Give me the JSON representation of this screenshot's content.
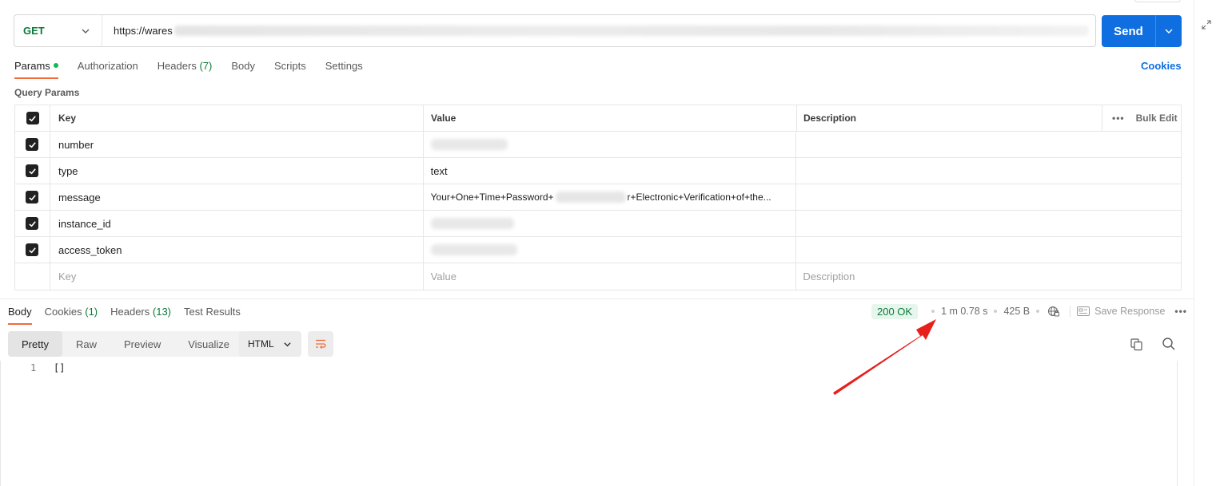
{
  "request": {
    "method": "GET",
    "url_prefix": "https://wares",
    "send_label": "Send"
  },
  "request_tabs": [
    {
      "label": "Params",
      "count": ""
    },
    {
      "label": "Authorization",
      "count": ""
    },
    {
      "label": "Headers",
      "count": "(7)"
    },
    {
      "label": "Body",
      "count": ""
    },
    {
      "label": "Scripts",
      "count": ""
    },
    {
      "label": "Settings",
      "count": ""
    }
  ],
  "cookies_link": "Cookies",
  "query_params": {
    "section_label": "Query Params",
    "headers": {
      "key": "Key",
      "value": "Value",
      "description": "Description",
      "bulk_edit": "Bulk Edit"
    },
    "rows": [
      {
        "key": "number",
        "value": ""
      },
      {
        "key": "type",
        "value": "text"
      },
      {
        "key": "message",
        "value_start": "Your+One+Time+Password+",
        "value_end": "r+Electronic+Verification+of+the..."
      },
      {
        "key": "instance_id",
        "value": ""
      },
      {
        "key": "access_token",
        "value": ""
      }
    ],
    "placeholders": {
      "key": "Key",
      "value": "Value",
      "description": "Description"
    }
  },
  "response_tabs": [
    {
      "label": "Body",
      "count": ""
    },
    {
      "label": "Cookies",
      "count": "(1)"
    },
    {
      "label": "Headers",
      "count": "(13)"
    },
    {
      "label": "Test Results",
      "count": ""
    }
  ],
  "response_status": {
    "status": "200 OK",
    "time": "1 m 0.78 s",
    "size": "425 B",
    "save_response": "Save Response"
  },
  "view_modes": [
    "Pretty",
    "Raw",
    "Preview",
    "Visualize"
  ],
  "format": "HTML",
  "editor": {
    "line_number": "1",
    "content": "[]"
  },
  "colors": {
    "send_button": "#0f6fe0",
    "method_get": "#0b7a3a",
    "active_tab_underline": "#f26b3a",
    "status_ok_bg": "#e6f6ec",
    "annotation_arrow": "#e8201c"
  }
}
